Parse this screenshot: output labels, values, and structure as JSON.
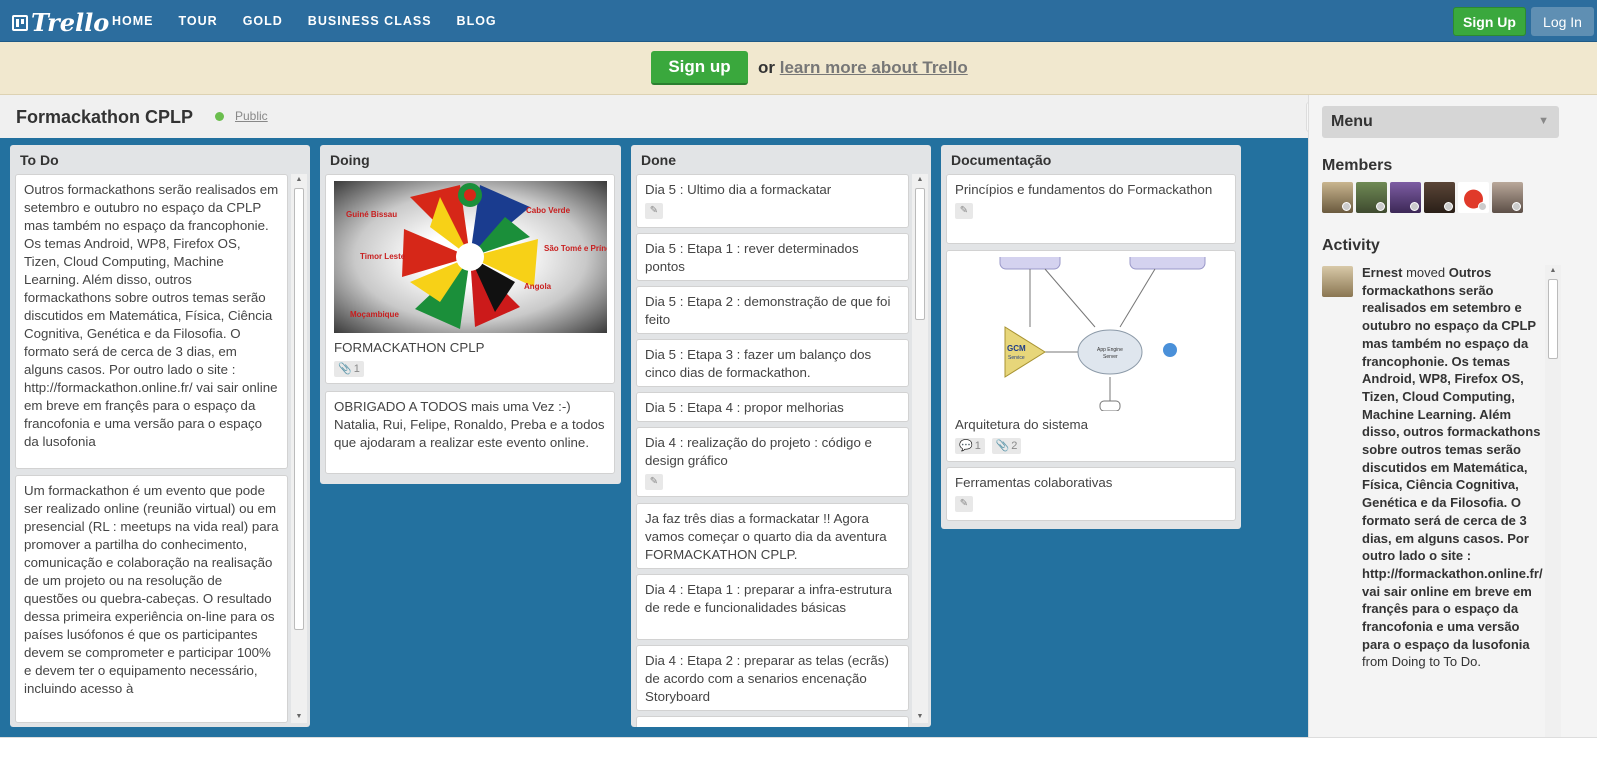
{
  "header": {
    "logo": "Trello",
    "nav": [
      "HOME",
      "TOUR",
      "GOLD",
      "BUSINESS CLASS",
      "BLOG"
    ],
    "signup": "Sign Up",
    "login": "Log In"
  },
  "banner": {
    "signup": "Sign up",
    "or": "or",
    "learn": "learn more about Trello"
  },
  "board": {
    "title": "Formackathon CPLP",
    "visibility": "Public"
  },
  "lists": {
    "todo": {
      "title": "To Do",
      "cards": [
        "Outros formackathons serão realisados em setembro e outubro no espaço da CPLP mas também no espaço da francophonie. Os temas Android, WP8, Firefox OS, Tizen, Cloud Computing, Machine Learning. Além disso, outros formackathons sobre outros temas serão discutidos em Matemática, Física, Ciência Cognitiva, Genética e da Filosofia. O formato será de cerca de 3 dias, em alguns casos. Por outro lado o site : http://formackathon.online.fr/ vai sair online em breve em françês para o espaço da francofonia e uma versão para o espaço da lusofonia",
        "Um formackathon é um evento que pode ser realizado online (reunião virtual) ou em presencial (RL : meetups na vida real) para promover a partilha do conhecimento, comunicação e colaboração na realisação de um projeto ou na resolução de questões ou quebra-cabeças. O resultado dessa primeira experiência on-line para os países lusófonos é que os participantes devem se comprometer e participar 100% e devem ter o equipamento necessário, incluindo acesso à"
      ]
    },
    "doing": {
      "title": "Doing",
      "cover_labels": [
        "Guiné Bissau",
        "Cabo Verde",
        "Timor Leste",
        "São Tomé e Príncipe",
        "Moçambique",
        "Angola"
      ],
      "cards": [
        {
          "text": "FORMACKATHON CPLP",
          "attachments": "1"
        },
        {
          "text": "OBRIGADO A TODOS mais uma Vez :-) Natalia, Rui, Felipe, Ronaldo, Preba e a todos que ajodaram a realizar este evento online."
        }
      ]
    },
    "done": {
      "title": "Done",
      "cards": [
        "Dia 5 : Ultimo dia a formackatar",
        "Dia 5 : Etapa 1 : rever determinados pontos",
        "Dia 5 : Etapa 2 : demonstração de que foi feito",
        "Dia 5 : Etapa 3 : fazer um balanço dos cinco dias de formackathon.",
        "Dia 5 : Etapa 4 : propor melhorias",
        "Dia 4 : realização do projeto : código e design gráfico",
        "Ja faz três dias a formackatar !! Agora vamos começar o quarto dia da aventura FORMACKATHON CPLP.",
        "Dia 4 : Etapa 1 : preparar a infra-estrutura de rede e funcionalidades básicas",
        "Dia 4 : Etapa 2 : preparar as telas (ecrãs) de acordo com a senarios encenação Storyboard"
      ]
    },
    "doc": {
      "title": "Documentação",
      "diagram": {
        "gcm": "GCM",
        "gcm_sub": "Service",
        "server": "App Engine",
        "server_sub": "Server"
      },
      "cards": [
        {
          "text": "Princípios e fundamentos do Formackathon"
        },
        {
          "text": "Arquitetura do sistema",
          "comments": "1",
          "attachments": "2"
        },
        {
          "text": "Ferramentas colaborativas"
        }
      ]
    }
  },
  "sidebar": {
    "menu": "Menu",
    "members_title": "Members",
    "activity_title": "Activity",
    "activity": {
      "user": "Ernest",
      "action": "moved",
      "card": "Outros formackathons serão realisados em setembro e outubro no espaço da CPLP mas também no espaço da francophonie. Os temas Android, WP8, Firefox OS, Tizen, Cloud Computing, Machine Learning. Além disso, outros formackathons sobre outros temas serão discutidos em Matemática, Física, Ciência Cognitiva, Genética e da Filosofia. O formato será de cerca de 3 dias, em alguns casos. Por outro lado o site : http://formackathon.online.fr/ vai sair online em breve em françês para o espaço da francofonia e uma versão para o espaço da lusofonia",
      "from": "from",
      "route": "Doing to To Do."
    }
  },
  "colors": {
    "board_bg": "#23719f",
    "header_bg": "#2c6d9e",
    "green": "#3aa83d",
    "banner_bg": "#f1e8cf",
    "list_bg": "#e2e4e6"
  }
}
